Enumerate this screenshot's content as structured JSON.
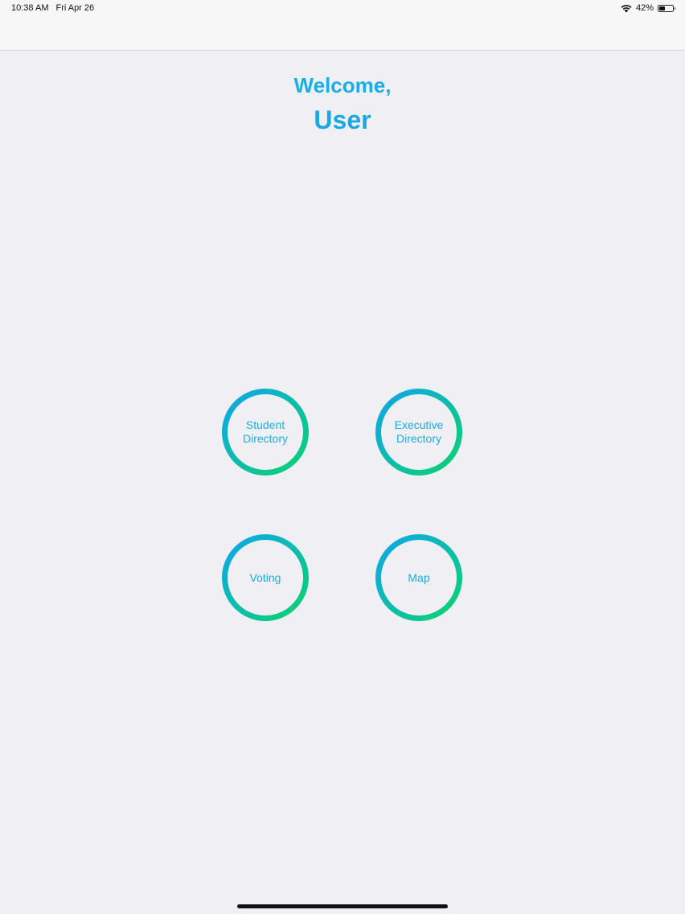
{
  "status_bar": {
    "time": "10:38 AM",
    "date": "Fri Apr 26",
    "battery": "42%",
    "battery_level": 0.42
  },
  "welcome": {
    "greeting": "Welcome,",
    "user": "User"
  },
  "menu": {
    "student_directory": "Student\nDirectory",
    "executive_directory": "Executive\nDirectory",
    "voting": "Voting",
    "map": "Map"
  },
  "colors": {
    "accent_text": "#1aaee8",
    "gradient_start": "#0ea5ee",
    "gradient_end": "#0bd46a",
    "background": "#efeff4"
  }
}
